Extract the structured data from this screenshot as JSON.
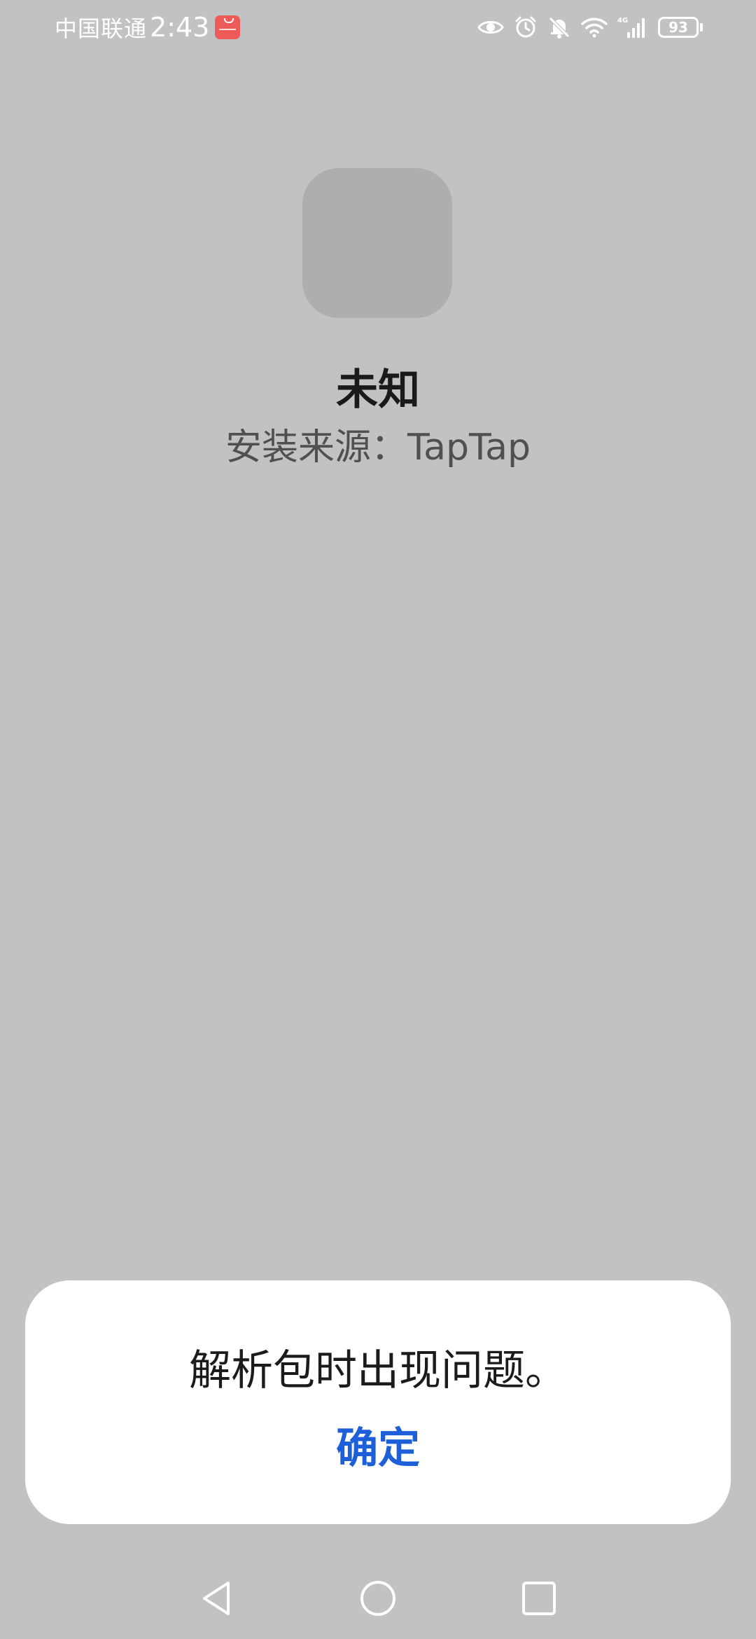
{
  "status_bar": {
    "carrier": "中国联通",
    "time": "2:43",
    "notification_app": "huawei-appgallery-icon",
    "icons": [
      "eye-icon",
      "alarm-icon",
      "mute-icon",
      "wifi-icon",
      "signal-4g-icon"
    ],
    "network_label": "4G",
    "battery": "93"
  },
  "app": {
    "name": "未知",
    "source": "安装来源：TapTap"
  },
  "dialog": {
    "message": "解析包时出现问题。",
    "ok_label": "确定",
    "ok_color": "#1c5fd8"
  },
  "nav": {
    "buttons": [
      "back-icon",
      "home-icon",
      "recents-icon"
    ]
  },
  "colors": {
    "background": "#c1c2c4",
    "icon_placeholder": "#adaeb0"
  }
}
